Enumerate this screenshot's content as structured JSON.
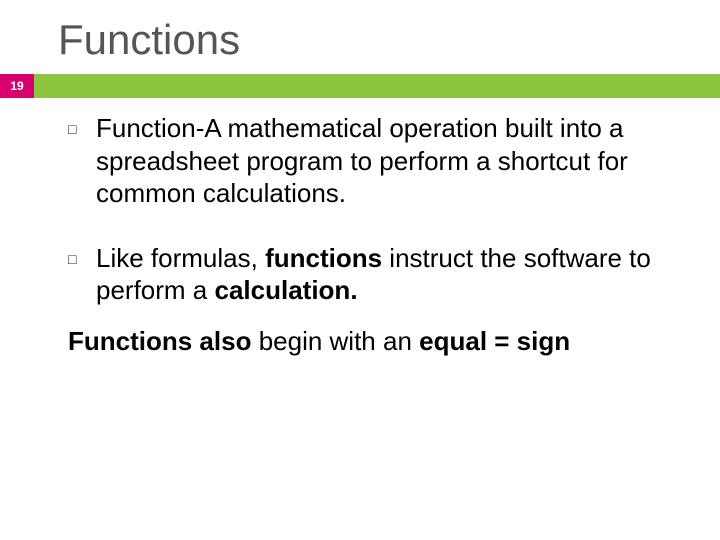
{
  "slide": {
    "title": "Functions",
    "page_number": "19",
    "bullets": [
      {
        "text": "Function-A mathematical operation built into a spreadsheet program to perform a shortcut for common calculations."
      },
      {
        "html": "Like formulas, <b>functions</b> instruct the software to perform a <b>calculation.</b>"
      }
    ],
    "footer_html": "<b>Functions also</b> begin with an <b>equal = sign</b>"
  }
}
